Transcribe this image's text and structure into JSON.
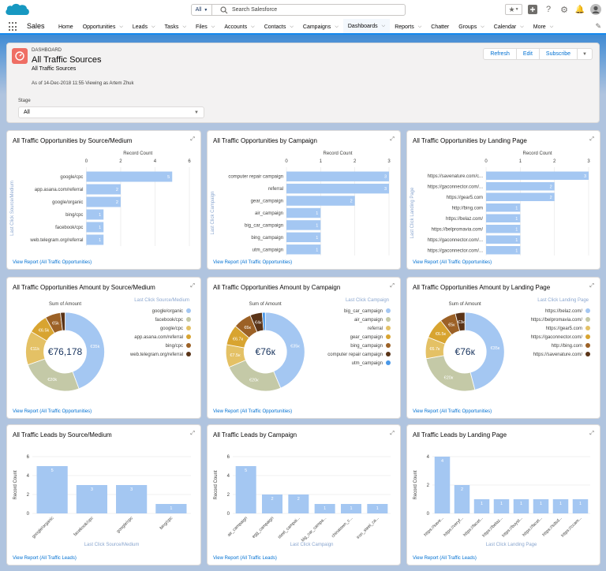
{
  "app": {
    "name": "Sales"
  },
  "search": {
    "scope": "All",
    "placeholder": "Search Salesforce"
  },
  "nav": {
    "items": [
      {
        "label": "Home",
        "chev": false
      },
      {
        "label": "Opportunities",
        "chev": true
      },
      {
        "label": "Leads",
        "chev": true
      },
      {
        "label": "Tasks",
        "chev": true
      },
      {
        "label": "Files",
        "chev": true
      },
      {
        "label": "Accounts",
        "chev": true
      },
      {
        "label": "Contacts",
        "chev": true
      },
      {
        "label": "Campaigns",
        "chev": true
      },
      {
        "label": "Dashboards",
        "chev": true,
        "active": true
      },
      {
        "label": "Reports",
        "chev": true
      },
      {
        "label": "Chatter",
        "chev": false
      },
      {
        "label": "Groups",
        "chev": true
      },
      {
        "label": "Calendar",
        "chev": true
      },
      {
        "label": "More",
        "chev": true
      }
    ]
  },
  "header": {
    "object_label": "DASHBOARD",
    "title": "All Traffic Sources",
    "description": "All Traffic Sources",
    "as_of": "As of 14-Dec-2018 11:55·Viewing as Artem Zhuk",
    "buttons": [
      "Refresh",
      "Edit",
      "Subscribe"
    ],
    "menu_icon": "chevron-down-icon"
  },
  "filter": {
    "label": "Stage",
    "value": "All"
  },
  "colors": {
    "bar": "#a4c7f2",
    "donut": [
      "#a4c7f2",
      "#c4c9a7",
      "#e4c165",
      "#d8a430",
      "#9c6126",
      "#5a3418",
      "#4a98e8"
    ]
  },
  "cards": [
    {
      "title": "All Traffic Opportunities by Source/Medium",
      "footer": "View Report (All Traffic Opportunities)",
      "chart_data": {
        "type": "bar",
        "orientation": "horizontal",
        "title": "Record Count",
        "ylabel": "Last Click Source/Medium",
        "xlim": [
          0,
          6
        ],
        "ticks": [
          "0",
          "2",
          "4",
          "6"
        ],
        "categories": [
          "google/cpc",
          "app.asana.com/referral",
          "google/organic",
          "bing/cpc",
          "facebook/cpc",
          "web.telegram.org/referral"
        ],
        "values": [
          5,
          2,
          2,
          1,
          1,
          1
        ]
      }
    },
    {
      "title": "All Traffic Opportunities by Campaign",
      "footer": "View Report (All Traffic Opportunities)",
      "chart_data": {
        "type": "bar",
        "orientation": "horizontal",
        "title": "Record Count",
        "ylabel": "Last Click Campaign",
        "xlim": [
          0,
          3
        ],
        "ticks": [
          "0",
          "1",
          "2",
          "3"
        ],
        "categories": [
          "computer repair campaign",
          "referral",
          "gear_campaign",
          "air_campaign",
          "big_car_campaign",
          "bing_campaign",
          "utm_campaign"
        ],
        "values": [
          3,
          3,
          2,
          1,
          1,
          1,
          1
        ]
      }
    },
    {
      "title": "All Traffic Opportunities by Landing Page",
      "footer": "View Report (All Traffic Opportunities)",
      "chart_data": {
        "type": "bar",
        "orientation": "horizontal",
        "title": "Record Count",
        "ylabel": "Last Click Landing Page",
        "xlim": [
          0,
          3
        ],
        "ticks": [
          "0",
          "1",
          "2",
          "3"
        ],
        "categories": [
          "https://savenature.com/c...",
          "https://gaconnector.com/...",
          "https://gear5.com",
          "http://bing.com",
          "https://belaz.com/",
          "https://belpromavia.com/",
          "https://gaconnector.com/...",
          "https://gaconnector.com/..."
        ],
        "values": [
          3,
          2,
          2,
          1,
          1,
          1,
          1,
          1
        ]
      }
    },
    {
      "title": "All Traffic Opportunities Amount by Source/Medium",
      "footer": "View Report (All Traffic Opportunities)",
      "chart_data": {
        "type": "pie",
        "variant": "donut",
        "title": "Sum of Amount",
        "legend_title": "Last Click Source/Medium",
        "center": "€76,178",
        "labels": [
          "google/organic",
          "facebook/cpc",
          "google/cpc",
          "app.asana.com/referral",
          "bing/cpc",
          "web.telegram.org/referral"
        ],
        "values": [
          35,
          20,
          11,
          6.5,
          5,
          1.5
        ],
        "slice_labels": [
          "€35k",
          "€20k",
          "€11k",
          "€6.5k",
          "€5k",
          ""
        ]
      }
    },
    {
      "title": "All Traffic Opportunities Amount by Campaign",
      "footer": "View Report (All Traffic Opportunities)",
      "chart_data": {
        "type": "pie",
        "variant": "donut",
        "title": "Sum of Amount",
        "legend_title": "Last Click Campaign",
        "center": "€76к",
        "labels": [
          "big_car_campaign",
          "air_campaign",
          "referral",
          "gear_campaign",
          "bing_campaign",
          "computer repair campaign",
          "utm_campaign"
        ],
        "values": [
          35,
          20,
          7.5,
          6.7,
          6,
          4,
          1
        ],
        "slice_labels": [
          "€35к",
          "€20к",
          "€7.5к",
          "€6.7к",
          "€6к",
          "€4к",
          ""
        ]
      }
    },
    {
      "title": "All Traffic Opportunities Amount by Landing Page",
      "footer": "View Report (All Traffic Opportunities)",
      "chart_data": {
        "type": "pie",
        "variant": "donut",
        "title": "Sum of Amount",
        "legend_title": "Last Click Landing Page",
        "center": "€76к",
        "labels": [
          "https://belaz.com/",
          "https://belpromavia.com/",
          "https://gear5.com",
          "https://gaconnector.com/",
          "http://bing.com",
          "https://savenature.com/"
        ],
        "values": [
          35,
          20,
          6.7,
          6.5,
          5,
          3
        ],
        "slice_labels": [
          "€35к",
          "€20к",
          "€6.7к",
          "€6.5к",
          "€5к",
          "€3к"
        ]
      }
    },
    {
      "title": "All Traffic Leads by Source/Medium",
      "footer": "View Report (All Traffic Leads)",
      "chart_data": {
        "type": "bar",
        "orientation": "vertical",
        "ylabel": "Record Count",
        "xlabel": "Last Click Source/Medium",
        "ylim": [
          0,
          6
        ],
        "ticks": [
          "0",
          "2",
          "4",
          "6"
        ],
        "categories": [
          "google/organic",
          "facebook/cpc",
          "google/cpc",
          "bing/cpc"
        ],
        "values": [
          5,
          3,
          3,
          1
        ]
      }
    },
    {
      "title": "All Traffic Leads by Campaign",
      "footer": "View Report (All Traffic Leads)",
      "chart_data": {
        "type": "bar",
        "orientation": "vertical",
        "ylabel": "Record Count",
        "xlabel": "Last Click Campaign",
        "ylim": [
          0,
          6
        ],
        "ticks": [
          "0",
          "2",
          "4",
          "6"
        ],
        "categories": [
          "air_campaign",
          "egg_campaign",
          "steel_campai...",
          "big_car_campa...",
          "chinatown_c...",
          "iron_steel_ca..."
        ],
        "values": [
          5,
          2,
          2,
          1,
          1,
          1
        ]
      }
    },
    {
      "title": "All Traffic Leads by Landing Page",
      "footer": "View Report (All Traffic Leads)",
      "chart_data": {
        "type": "bar",
        "orientation": "vertical",
        "ylabel": "Record Count",
        "xlabel": "Last Click Landing Page",
        "ylim": [
          0,
          4
        ],
        "ticks": [
          "0",
          "2",
          "4"
        ],
        "categories": [
          "https://save...",
          "https://veryf...",
          "https://facet...",
          "https://belaz...",
          "https://buyst...",
          "https://facet...",
          "https://sdsd...",
          "https://ccam..."
        ],
        "values": [
          4,
          2,
          1,
          1,
          1,
          1,
          1,
          1
        ]
      }
    }
  ]
}
